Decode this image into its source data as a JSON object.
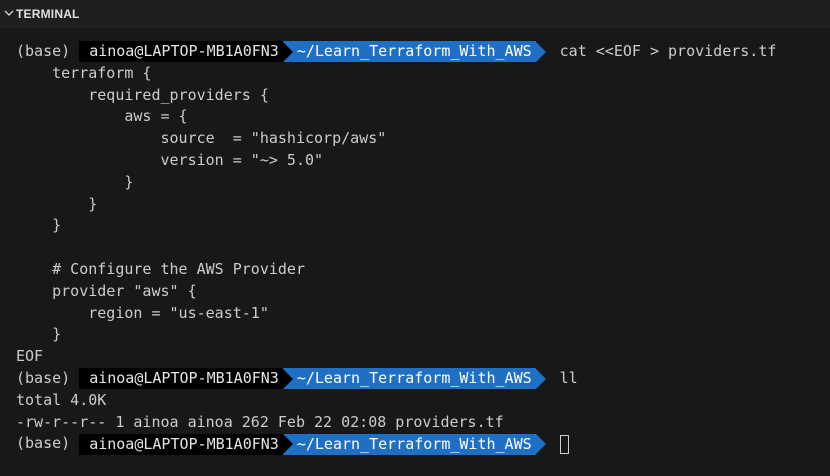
{
  "panel": {
    "title": "TERMINAL"
  },
  "prompt": {
    "env": "(base)",
    "user_host": "ainoa@LAPTOP-MB1A0FN3",
    "path": "~/Learn_Terraform_With_AWS"
  },
  "commands": {
    "first": "cat <<EOF > providers.tf",
    "second": "ll"
  },
  "heredoc_lines": [
    "    terraform {",
    "        required_providers {",
    "            aws = {",
    "                source  = \"hashicorp/aws\"",
    "                version = \"~> 5.0\"",
    "            }",
    "        }",
    "    }",
    "",
    "    # Configure the AWS Provider",
    "    provider \"aws\" {",
    "        region = \"us-east-1\"",
    "    }",
    "EOF"
  ],
  "ls_output": {
    "total": "total 4.0K",
    "file_line": "-rw-r--r-- 1 ainoa ainoa 262 Feb 22 02:08 providers.tf"
  },
  "colors": {
    "background": "#181818",
    "header_background": "#1f1f1f",
    "user_segment": "#000000",
    "path_segment": "#1f6fc5",
    "text": "#cccccc"
  },
  "icons": {
    "collapse": "chevron-down-icon"
  }
}
